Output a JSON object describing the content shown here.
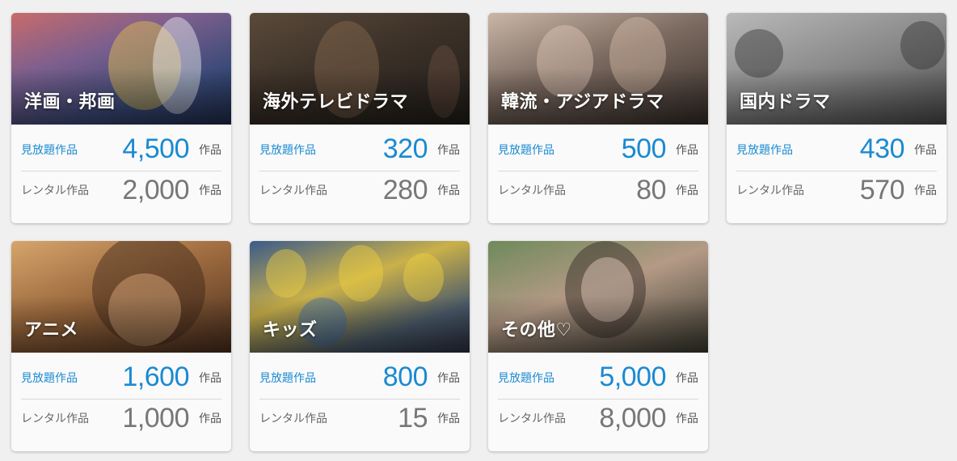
{
  "labels": {
    "unlimited": "見放題作品",
    "rental": "レンタル作品",
    "unit": "作品"
  },
  "cards": [
    {
      "title": "洋画・邦画",
      "unlimited": "4,500",
      "rental": "2,000"
    },
    {
      "title": "海外テレビドラマ",
      "unlimited": "320",
      "rental": "280"
    },
    {
      "title": "韓流・アジアドラマ",
      "unlimited": "500",
      "rental": "80"
    },
    {
      "title": "国内ドラマ",
      "unlimited": "430",
      "rental": "570"
    },
    {
      "title": "アニメ",
      "unlimited": "1,600",
      "rental": "1,000"
    },
    {
      "title": "キッズ",
      "unlimited": "800",
      "rental": "15"
    },
    {
      "title": "その他♡",
      "unlimited": "5,000",
      "rental": "8,000"
    }
  ],
  "colors": {
    "accent": "#1a8ad2",
    "secondary_text": "#777777",
    "background": "#f0f0f0"
  }
}
